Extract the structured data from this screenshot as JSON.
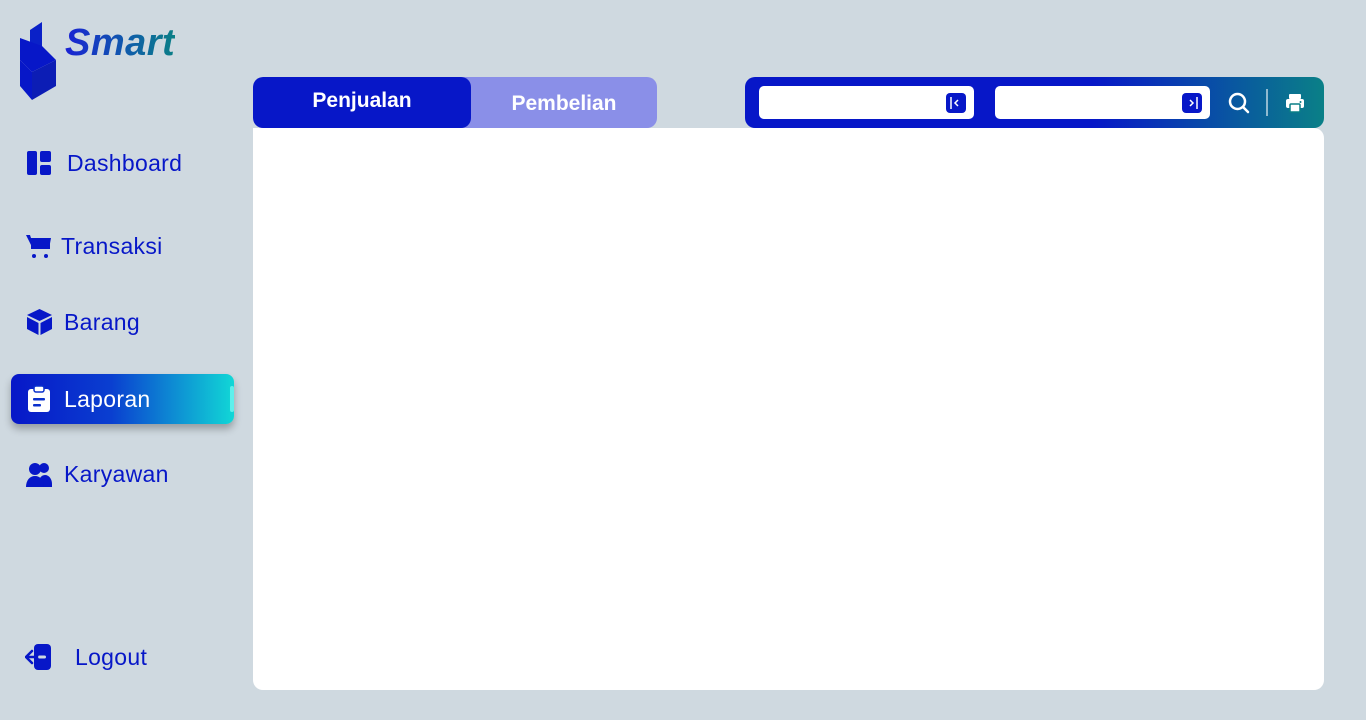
{
  "app": {
    "name": "Smart",
    "brand_colors": {
      "primary": "#0717c8",
      "teal": "#0a8087",
      "cyan": "#11d7d6",
      "background": "#cfd9e0"
    }
  },
  "sidebar": {
    "items": [
      {
        "label": "Dashboard",
        "icon": "dashboard-icon",
        "active": false
      },
      {
        "label": "Transaksi",
        "icon": "cart-icon",
        "active": false
      },
      {
        "label": "Barang",
        "icon": "box-icon",
        "active": false
      },
      {
        "label": "Laporan",
        "icon": "clipboard-icon",
        "active": true
      },
      {
        "label": "Karyawan",
        "icon": "users-icon",
        "active": false
      }
    ],
    "logout_label": "Logout"
  },
  "tabs": [
    {
      "label": "Penjualan",
      "active": true
    },
    {
      "label": "Pembelian",
      "active": false
    }
  ],
  "filters": {
    "start_date": {
      "value": "",
      "placeholder": ""
    },
    "end_date": {
      "value": "",
      "placeholder": ""
    },
    "icons": [
      "search-icon",
      "printer-icon"
    ]
  }
}
